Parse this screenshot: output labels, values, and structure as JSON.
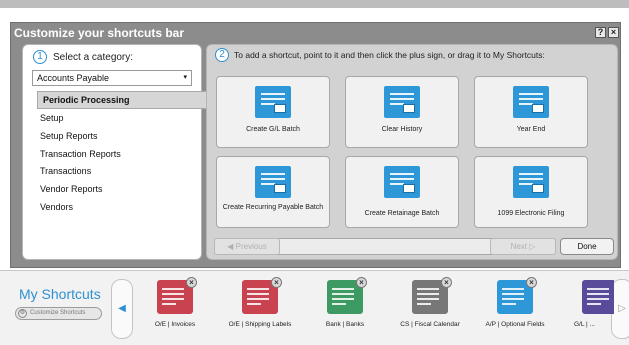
{
  "dialog": {
    "title": "Customize your shortcuts bar",
    "help_label": "?",
    "close_label": "×"
  },
  "left_pane": {
    "step_number": "1",
    "step_text": "Select a category:",
    "selected_category": "Accounts Payable",
    "caret": "▾",
    "items": [
      {
        "label": "Periodic Processing",
        "selected": true
      },
      {
        "label": "Setup"
      },
      {
        "label": "Setup Reports"
      },
      {
        "label": "Transaction Reports"
      },
      {
        "label": "Transactions"
      },
      {
        "label": "Vendor Reports"
      },
      {
        "label": "Vendors"
      }
    ]
  },
  "right_pane": {
    "step_number": "2",
    "step_text": "To add a shortcut, point to it and then click the plus sign, or drag it to My Shortcuts:",
    "tiles": [
      {
        "label": "Create G/L Batch"
      },
      {
        "label": "Clear History"
      },
      {
        "label": "Year End"
      },
      {
        "label": "Create Recurring Payable Batch"
      },
      {
        "label": "Create Retainage Batch"
      },
      {
        "label": "1099 Electronic Filing"
      }
    ],
    "previous_label": "Previous",
    "next_label": "Next",
    "done_label": "Done"
  },
  "dock": {
    "title": "My Shortcuts",
    "customize_label": "Customize Shortcuts",
    "left_arrow": "◀",
    "right_arrow": "▷",
    "items": [
      {
        "label": "O/E | Invoices",
        "color": "#c9424f"
      },
      {
        "label": "O/E | Shipping Labels",
        "color": "#c9424f"
      },
      {
        "label": "Bank | Banks",
        "color": "#3d9a62"
      },
      {
        "label": "CS | Fiscal Calendar",
        "color": "#777777"
      },
      {
        "label": "A/P | Optional Fields",
        "color": "#2d97d8"
      },
      {
        "label": "G/L | ...",
        "color": "#5a4a9a"
      }
    ]
  },
  "colors": {
    "accent": "#2f90cf",
    "panel_bg": "#8c8c8c",
    "tile_icon": "#2d97d8"
  }
}
